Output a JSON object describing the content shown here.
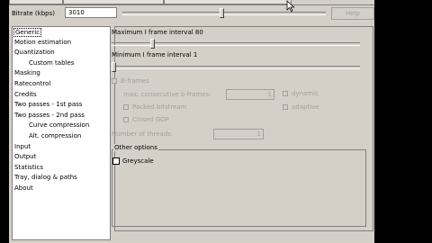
{
  "bitrate": {
    "label": "Bitrate (kbps)",
    "value": "3010",
    "slider_level": 0.49
  },
  "help_label": "Help",
  "sidebar": {
    "items": [
      {
        "label": "Generic",
        "level": 0,
        "selected": true
      },
      {
        "label": "Motion estimation",
        "level": 0
      },
      {
        "label": "Quantization",
        "level": 0
      },
      {
        "label": "Custom tables",
        "level": 1
      },
      {
        "label": "Masking",
        "level": 0
      },
      {
        "label": "Ratecontrol",
        "level": 0
      },
      {
        "label": "Credits",
        "level": 0
      },
      {
        "label": "Two passes - 1st pass",
        "level": 0
      },
      {
        "label": "Two passes - 2nd pass",
        "level": 0
      },
      {
        "label": "Curve compression",
        "level": 1
      },
      {
        "label": "Alt. compression",
        "level": 1
      },
      {
        "label": "Input",
        "level": 0
      },
      {
        "label": "Output",
        "level": 0
      },
      {
        "label": "Statistics",
        "level": 0
      },
      {
        "label": "Tray, dialog & paths",
        "level": 0
      },
      {
        "label": "About",
        "level": 0
      }
    ]
  },
  "generic": {
    "max_iframe_label": "Maximum I frame interval 80",
    "max_iframe_level": 0.16,
    "min_iframe_label": "Minimum I frame interval 1",
    "min_iframe_level": 0.0,
    "bframes_label": "B-frames",
    "max_consec_label": "max. consecutive b-frames:",
    "max_consec_value": "1",
    "dynamic_label": "dynamic",
    "packed_label": "Packed bitstream",
    "adaptive_label": "adaptive",
    "closed_gop_label": "Closed GOP",
    "threads_label": "Number of threads:",
    "threads_value": "1",
    "other_options_label": "Other options",
    "greyscale_label": "Greyscale"
  }
}
